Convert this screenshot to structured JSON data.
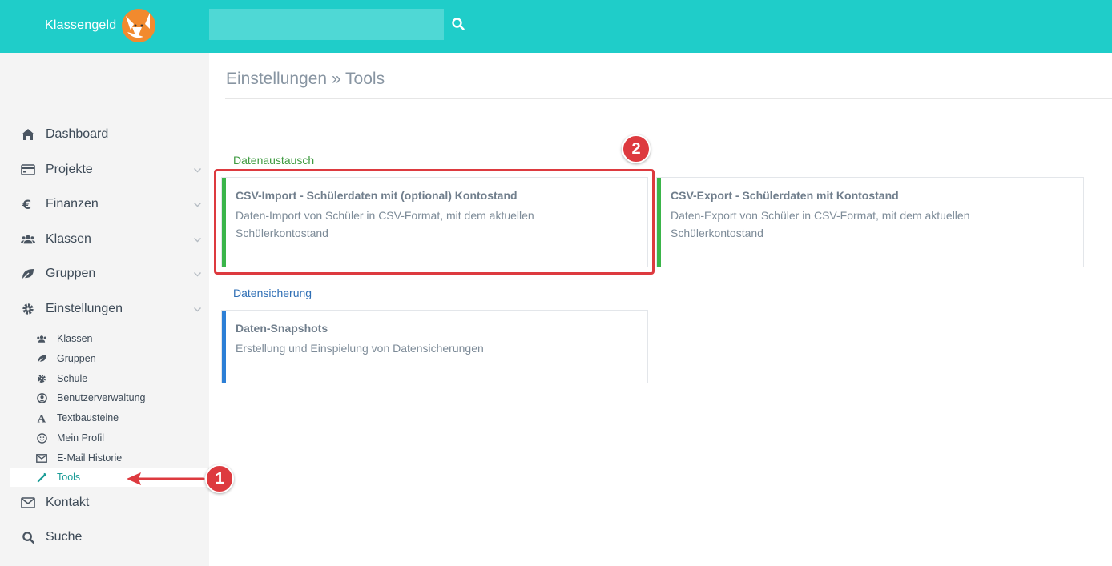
{
  "app": {
    "name": "Klassengeld"
  },
  "search": {
    "placeholder": ""
  },
  "sidebar": {
    "items": [
      {
        "label": "Dashboard"
      },
      {
        "label": "Projekte"
      },
      {
        "label": "Finanzen"
      },
      {
        "label": "Klassen"
      },
      {
        "label": "Gruppen"
      },
      {
        "label": "Einstellungen"
      },
      {
        "label": "Kontakt"
      },
      {
        "label": "Suche"
      }
    ],
    "settings_sub": [
      {
        "label": "Klassen"
      },
      {
        "label": "Gruppen"
      },
      {
        "label": "Schule"
      },
      {
        "label": "Benutzerverwaltung"
      },
      {
        "label": "Textbausteine"
      },
      {
        "label": "Mein Profil"
      },
      {
        "label": "E-Mail Historie"
      },
      {
        "label": "Tools"
      }
    ],
    "active_sub": "Tools"
  },
  "page": {
    "title": "Einstellungen » Tools",
    "sections": [
      {
        "label": "Datenaustausch",
        "color": "#3d9a3f",
        "cards": [
          {
            "title": "CSV-Import - Schülerdaten mit (optional) Kontostand",
            "description": "Daten-Import von Schüler in CSV-Format, mit dem aktuellen Schülerkontostand",
            "accent": "#3ab54a"
          },
          {
            "title": "CSV-Export - Schülerdaten mit Kontostand",
            "description": "Daten-Export von Schüler in CSV-Format, mit dem aktuellen Schülerkontostand",
            "accent": "#3ab54a"
          }
        ]
      },
      {
        "label": "Datensicherung",
        "color": "#2f6fb5",
        "cards": [
          {
            "title": "Daten-Snapshots",
            "description": "Erstellung und Einspielung von Datensicherungen",
            "accent": "#2c7fd6"
          }
        ]
      }
    ]
  },
  "annotations": {
    "badge_1": "1",
    "badge_2": "2",
    "color": "#dd3a3f"
  },
  "colors": {
    "topbar": "#1fcdc9",
    "sidebar_bg": "#f4f4f4",
    "active_link": "#1b9c97"
  }
}
